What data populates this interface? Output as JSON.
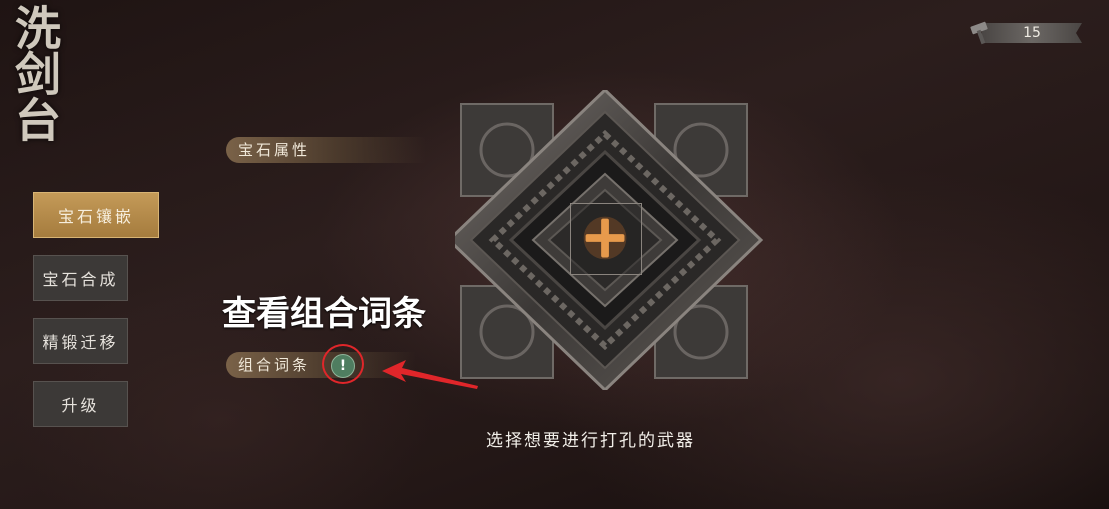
{
  "title": "洗剑台",
  "counter": {
    "value": "15",
    "icon": "hammer-icon"
  },
  "nav": {
    "items": [
      {
        "label": "宝石镶嵌",
        "active": true
      },
      {
        "label": "宝石合成",
        "active": false
      },
      {
        "label": "精锻迁移",
        "active": false
      },
      {
        "label": "升级",
        "active": false
      }
    ]
  },
  "sections": {
    "gem_attributes": "宝石属性",
    "combo_entries": "组合词条"
  },
  "alert_icon": "exclamation-icon",
  "annotation": {
    "text": "查看组合词条",
    "color": "#e0262a"
  },
  "slot": {
    "icon": "plus-icon",
    "hint": "选择想要进行打孔的武器"
  }
}
